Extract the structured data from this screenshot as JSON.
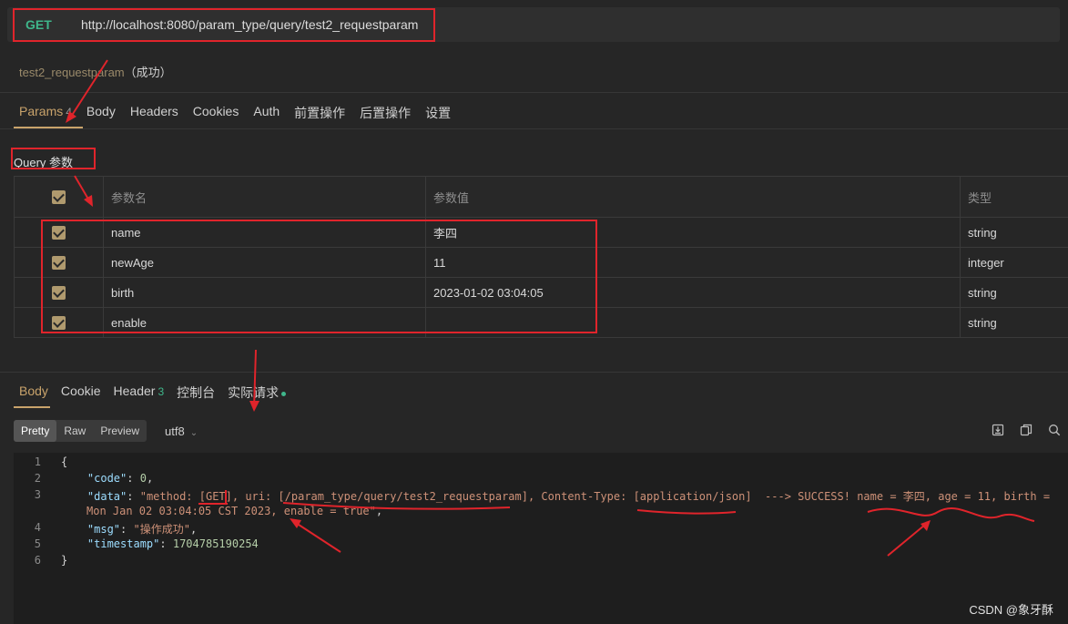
{
  "request": {
    "method": "GET",
    "url": "http://localhost:8080/param_type/query/test2_requestparam",
    "name": "test2_requestparam",
    "status": "（成功）"
  },
  "tabs": [
    {
      "label": "Params",
      "count": "4"
    },
    {
      "label": "Body"
    },
    {
      "label": "Headers"
    },
    {
      "label": "Cookies"
    },
    {
      "label": "Auth"
    },
    {
      "label": "前置操作"
    },
    {
      "label": "后置操作"
    },
    {
      "label": "设置"
    }
  ],
  "query": {
    "section_label": "Query 参数",
    "columns": {
      "name": "参数名",
      "value": "参数值",
      "type": "类型"
    },
    "rows": [
      {
        "name": "name",
        "value": "李四",
        "type": "string"
      },
      {
        "name": "newAge",
        "value": "11",
        "type": "integer"
      },
      {
        "name": "birth",
        "value": "2023-01-02 03:04:05",
        "type": "string"
      },
      {
        "name": "enable",
        "value": "",
        "type": "string"
      }
    ]
  },
  "response": {
    "tabs": [
      {
        "label": "Body"
      },
      {
        "label": "Cookie"
      },
      {
        "label": "Header",
        "count": "3"
      },
      {
        "label": "控制台"
      },
      {
        "label": "实际请求"
      }
    ],
    "view_modes": [
      "Pretty",
      "Raw",
      "Preview"
    ],
    "encoding": "utf8",
    "icons": [
      "download-icon",
      "copy-icon",
      "search-icon"
    ],
    "lines": [
      {
        "num": "1",
        "brace_open": "{"
      },
      {
        "num": "2",
        "key": "\"code\"",
        "value": "0",
        "value_type": "number"
      },
      {
        "num": "3",
        "key": "\"data\"",
        "value": "\"method: [GET], uri: [/param_type/query/test2_requestparam], Content-Type: [application/json]  ---> SUCCESS! name = 李四, age = 11, birth =",
        "value_cont": "Mon Jan 02 03:04:05 CST 2023, enable = true\"",
        "value_type": "string"
      },
      {
        "num": "4",
        "key": "\"msg\"",
        "value": "\"操作成功\"",
        "value_type": "string"
      },
      {
        "num": "5",
        "key": "\"timestamp\"",
        "value": "1704785190254",
        "value_type": "number"
      },
      {
        "num": "6",
        "brace_close": "}"
      }
    ]
  },
  "watermark": "CSDN @象牙酥",
  "colors": {
    "accent": "#c9a36b",
    "method": "#3fb68b",
    "annotation": "#e0242b"
  }
}
